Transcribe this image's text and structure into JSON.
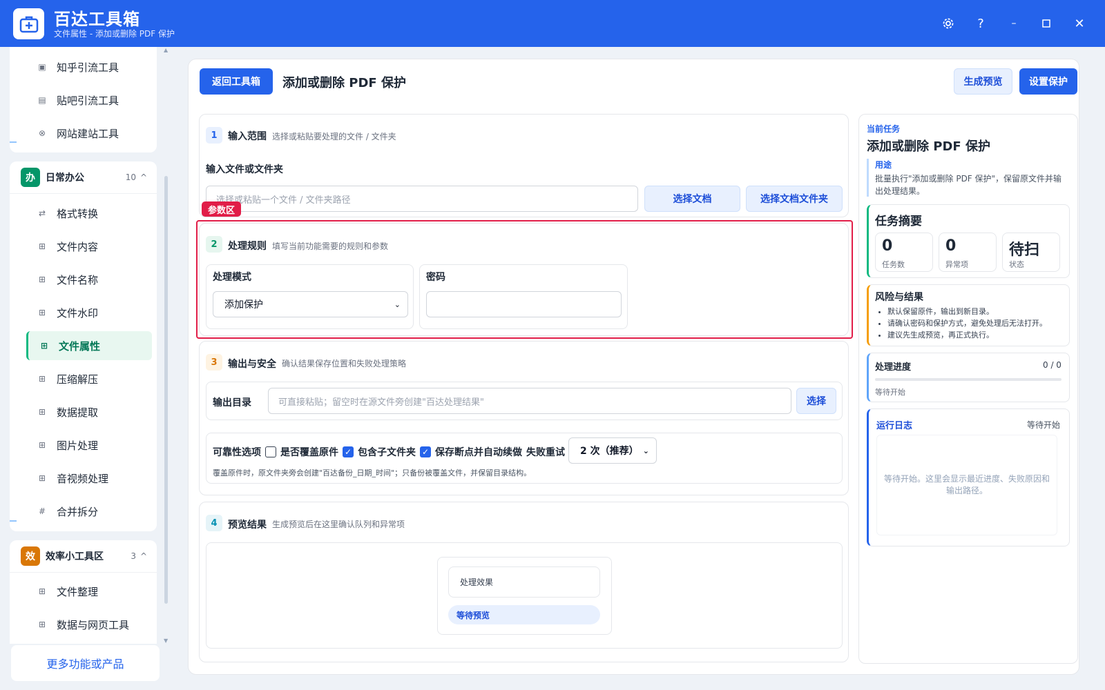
{
  "titlebar": {
    "title": "百达工具箱",
    "subtitle": "文件属性 - 添加或删除 PDF 保护"
  },
  "sidebar": {
    "top_items": [
      {
        "label": "知乎引流工具",
        "icon": "zhihu-icon"
      },
      {
        "label": "贴吧引流工具",
        "icon": "tieba-icon"
      },
      {
        "label": "网站建站工具",
        "icon": "website-icon"
      }
    ],
    "groups": [
      {
        "badge": "办",
        "badge_color": "#059669",
        "title": "日常办公",
        "count": "10",
        "items": [
          {
            "label": "格式转换",
            "icon": "swap-icon"
          },
          {
            "label": "文件内容",
            "icon": "grid-icon"
          },
          {
            "label": "文件名称",
            "icon": "grid-icon"
          },
          {
            "label": "文件水印",
            "icon": "grid-icon"
          },
          {
            "label": "文件属性",
            "icon": "grid-icon",
            "active": true
          },
          {
            "label": "压缩解压",
            "icon": "grid-icon"
          },
          {
            "label": "数据提取",
            "icon": "grid-icon"
          },
          {
            "label": "图片处理",
            "icon": "grid-icon"
          },
          {
            "label": "音视频处理",
            "icon": "grid-icon"
          },
          {
            "label": "合并拆分",
            "icon": "hash-icon"
          }
        ]
      },
      {
        "badge": "效",
        "badge_color": "#d97706",
        "title": "效率小工具区",
        "count": "3",
        "items": [
          {
            "label": "文件整理",
            "icon": "grid-icon"
          },
          {
            "label": "数据与网页工具",
            "icon": "grid-icon"
          }
        ]
      }
    ],
    "more_label": "更多功能或产品"
  },
  "header": {
    "back_label": "返回工具箱",
    "title": "添加或删除 PDF 保护",
    "preview_label": "生成预览",
    "apply_label": "设置保护"
  },
  "section1": {
    "num": "1",
    "title": "输入范围",
    "desc": "选择或粘贴要处理的文件 / 文件夹",
    "field_label": "输入文件或文件夹",
    "placeholder": "选择或粘贴一个文件 / 文件夹路径",
    "btn_file": "选择文档",
    "btn_folder": "选择文档文件夹"
  },
  "param_tag": "参数区",
  "section2": {
    "num": "2",
    "title": "处理规则",
    "desc": "填写当前功能需要的规则和参数",
    "mode_label": "处理模式",
    "mode_value": "添加保护",
    "password_label": "密码",
    "password_value": ""
  },
  "section3": {
    "num": "3",
    "title": "输出与安全",
    "desc": "确认结果保存位置和失败处理策略",
    "output_label": "输出目录",
    "output_placeholder": "可直接粘贴；留空时在源文件旁创建\"百达处理结果\"",
    "output_btn": "选择",
    "reliability_label": "可靠性选项",
    "overwrite_label": "是否覆盖原件",
    "overwrite_checked": false,
    "subfolder_label": "包含子文件夹",
    "subfolder_checked": true,
    "resume_label": "保存断点并自动续做",
    "resume_checked": true,
    "retry_label": "失败重试",
    "retry_value": "2 次（推荐）",
    "hint": "覆盖原件时，原文件夹旁会创建\"百达备份_日期_时间\"；只备份被覆盖文件，并保留目录结构。"
  },
  "section4": {
    "num": "4",
    "title": "预览结果",
    "desc": "生成预览后在这里确认队列和异常项",
    "effect_label": "处理效果",
    "status_label": "等待预览"
  },
  "right": {
    "current_label": "当前任务",
    "task_title": "添加或删除 PDF 保护",
    "purpose_label": "用途",
    "purpose_text": "批量执行\"添加或删除 PDF 保护\"，保留原文件并输出处理结果。",
    "summary_title": "任务摘要",
    "stats": [
      {
        "value": "0",
        "label": "任务数"
      },
      {
        "value": "0",
        "label": "异常项"
      },
      {
        "value": "待扫",
        "label": "状态"
      }
    ],
    "risk_title": "风险与结果",
    "risks": [
      "默认保留原件，输出到新目录。",
      "请确认密码和保护方式，避免处理后无法打开。",
      "建议先生成预览，再正式执行。"
    ],
    "progress_title": "处理进度",
    "progress_count": "0 / 0",
    "progress_value": 0,
    "progress_status": "等待开始",
    "log_title": "运行日志",
    "log_status": "等待开始",
    "log_placeholder": "等待开始。这里会显示最近进度、失败原因和输出路径。"
  },
  "colors": {
    "brand": "#2563eb",
    "active_green": "#10b981",
    "param_red": "#e11d48",
    "risk_orange": "#f59e0b"
  }
}
